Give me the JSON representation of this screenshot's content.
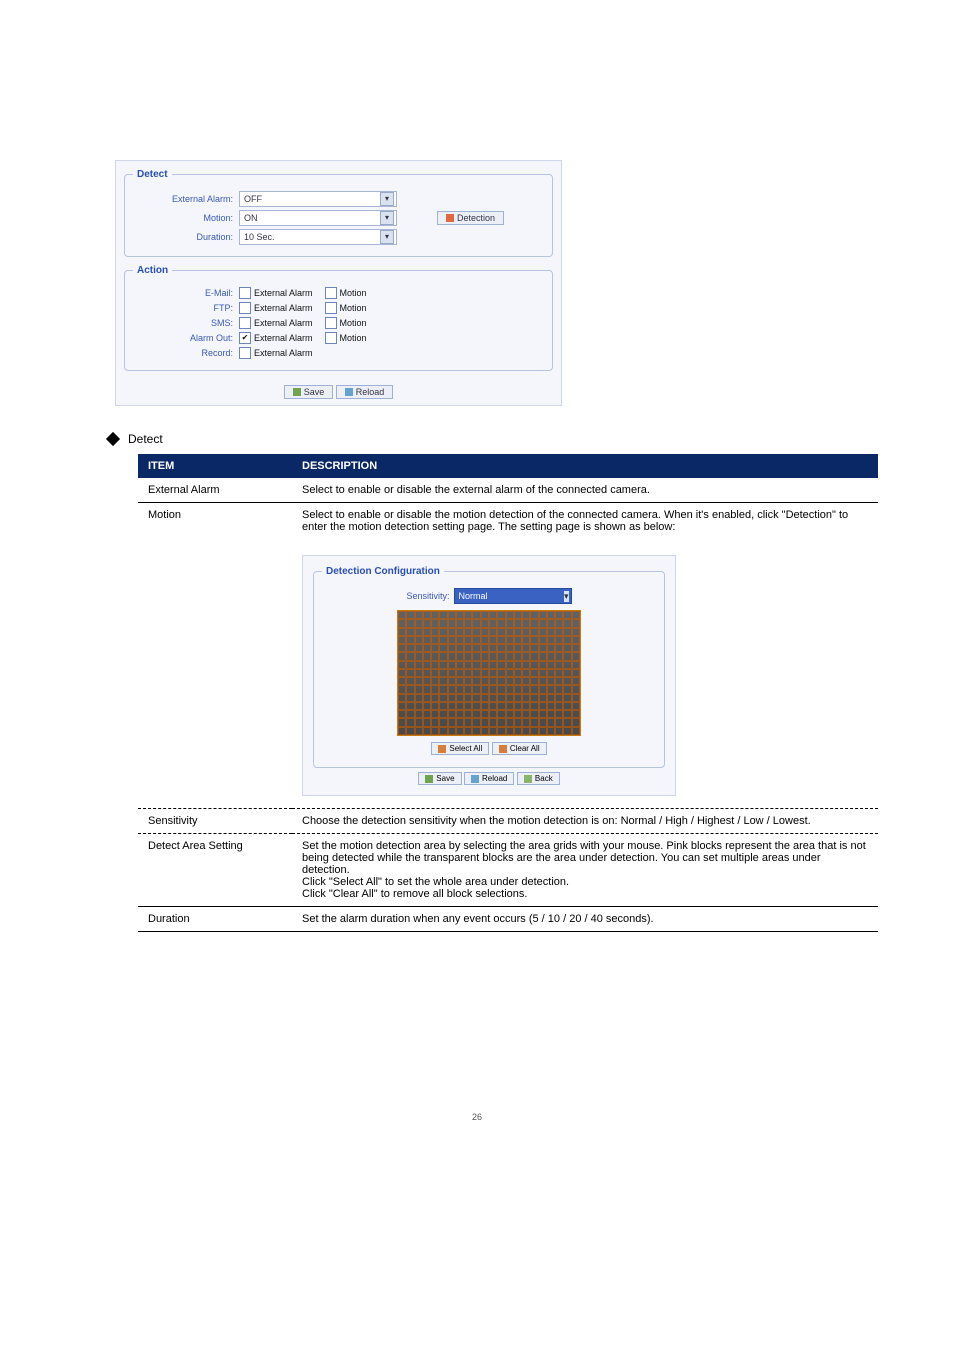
{
  "screenshot1": {
    "field_detect_legend": "Detect",
    "field_action_legend": "Action",
    "labels": {
      "external_alarm": "External Alarm:",
      "motion": "Motion:",
      "duration": "Duration:",
      "email": "E-Mail:",
      "ftp": "FTP:",
      "sms": "SMS:",
      "alarm_out": "Alarm Out:",
      "record": "Record:"
    },
    "selects": {
      "external_alarm": "OFF",
      "motion": "ON",
      "duration": "10 Sec."
    },
    "chk_label_ext": "External Alarm",
    "chk_label_motion": "Motion",
    "detection_btn": "Detection",
    "save_btn": "Save",
    "reload_btn": "Reload"
  },
  "diamond_heading": "Detect",
  "table": {
    "head_item": "ITEM",
    "head_desc": "DESCRIPTION",
    "rows": {
      "ext_alarm_item": "External Alarm",
      "ext_alarm_desc": "Select to enable or disable the external alarm of the connected camera.",
      "motion_item": "Motion",
      "motion_desc": "Select to enable or disable the motion detection of the connected camera. When it's enabled, click \"Detection\" to enter the motion detection setting page. The setting page is shown as below:",
      "sensitivity_item": "Sensitivity",
      "sensitivity_desc": "Choose the detection sensitivity when the motion detection is on: Normal / High / Highest / Low / Lowest.",
      "detect_area_item": "Detect Area Setting",
      "detect_area_desc": "Set the motion detection area by selecting the area grids with your mouse. Pink blocks represent the area that is not being detected while the transparent blocks are the area under detection. You can set multiple areas under detection.\nClick \"Select All\" to set the whole area under detection.\nClick \"Clear All\" to remove all block selections.",
      "duration_item": "Duration",
      "duration_desc": "Set the alarm duration when any event occurs (5 / 10 / 20 / 40 seconds)."
    }
  },
  "innershot": {
    "legend": "Detection Configuration",
    "sensitivity_label": "Sensitivity:",
    "sensitivity_value": "Normal",
    "select_all": "Select All",
    "clear_all": "Clear All",
    "save": "Save",
    "reload": "Reload",
    "back": "Back"
  },
  "footer": "26"
}
